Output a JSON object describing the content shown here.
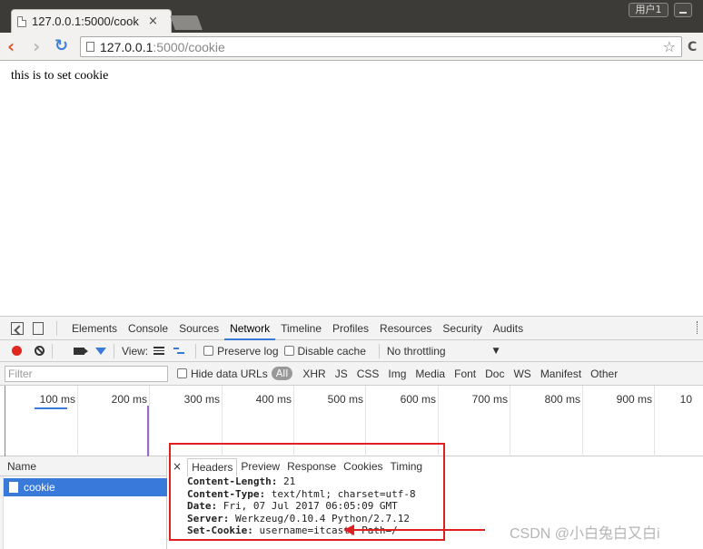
{
  "window": {
    "user_button": "用户1"
  },
  "tab": {
    "title": "127.0.0.1:5000/cook",
    "close": "×"
  },
  "address_bar": {
    "host": "127.0.0.1",
    "path": ":5000/cookie"
  },
  "page": {
    "text": "this is to set cookie"
  },
  "devtools": {
    "tabs": [
      "Elements",
      "Console",
      "Sources",
      "Network",
      "Timeline",
      "Profiles",
      "Resources",
      "Security",
      "Audits"
    ],
    "active_tab": "Network",
    "network_toolbar": {
      "view_label": "View:",
      "preserve_log": "Preserve log",
      "disable_cache": "Disable cache",
      "throttling": "No throttling"
    },
    "filter_bar": {
      "placeholder": "Filter",
      "hide_data_urls": "Hide data URLs",
      "all": "All",
      "types": [
        "XHR",
        "JS",
        "CSS",
        "Img",
        "Media",
        "Font",
        "Doc",
        "WS",
        "Manifest",
        "Other"
      ]
    },
    "timeline_labels": [
      "100 ms",
      "200 ms",
      "300 ms",
      "400 ms",
      "500 ms",
      "600 ms",
      "700 ms",
      "800 ms",
      "900 ms",
      "10"
    ],
    "request_list": {
      "header": "Name",
      "requests": [
        "cookie"
      ]
    },
    "details": {
      "close": "×",
      "tabs": [
        "Headers",
        "Preview",
        "Response",
        "Cookies",
        "Timing"
      ],
      "active_tab": "Headers",
      "headers": [
        {
          "key": "Content-Length:",
          "value": " 21"
        },
        {
          "key": "Content-Type:",
          "value": " text/html; charset=utf-8"
        },
        {
          "key": "Date:",
          "value": " Fri, 07 Jul 2017 06:05:09 GMT"
        },
        {
          "key": "Server:",
          "value": " Werkzeug/0.10.4 Python/2.7.12"
        },
        {
          "key": "Set-Cookie:",
          "value": " username=itcast; Path=/"
        }
      ]
    }
  },
  "watermark": "CSDN @小白兔白又白i",
  "colors": {
    "accent": "#3879d9",
    "annotation": "#e02020",
    "record": "#e0281f"
  }
}
